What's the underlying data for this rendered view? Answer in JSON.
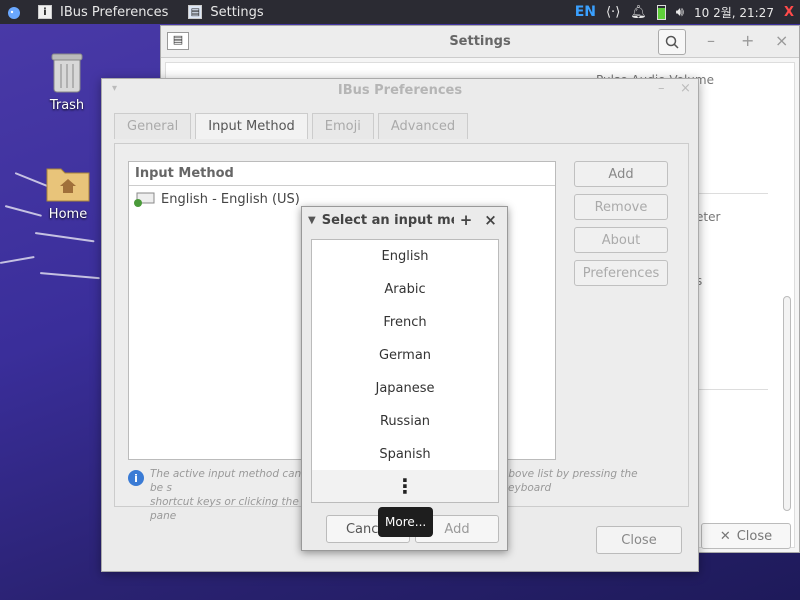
{
  "panel": {
    "tasks": [
      {
        "icon": "info-icon",
        "label": "IBus Preferences"
      },
      {
        "icon": "settings-window-icon",
        "label": "Settings"
      }
    ],
    "lang": "EN",
    "clock": "10 2월, 21:27"
  },
  "desktop": {
    "trash_label": "Trash",
    "home_label": "Home"
  },
  "settings": {
    "title": "Settings",
    "row1": "Pulse Audio Volume",
    "row2": "eter",
    "row3": "s",
    "close_label": "Close"
  },
  "ibus": {
    "title": "IBus Preferences",
    "tabs": [
      "General",
      "Input Method",
      "Emoji",
      "Advanced"
    ],
    "list_header": "Input Method",
    "list_item": "English - English (US)",
    "buttons": {
      "add": "Add",
      "remove": "Remove",
      "about": "About",
      "preferences": "Preferences"
    },
    "info_left": "The active input method can be s",
    "info_left2": "shortcut keys or clicking the pane",
    "info_right": "above list by pressing the keyboard",
    "close_label": "Close"
  },
  "dialog": {
    "title": "Select an input method",
    "options": [
      "English",
      "Arabic",
      "French",
      "German",
      "Japanese",
      "Russian",
      "Spanish"
    ],
    "more_glyph": "⋮",
    "cancel_label": "Cancel",
    "add_label": "Add",
    "tooltip": "More..."
  }
}
